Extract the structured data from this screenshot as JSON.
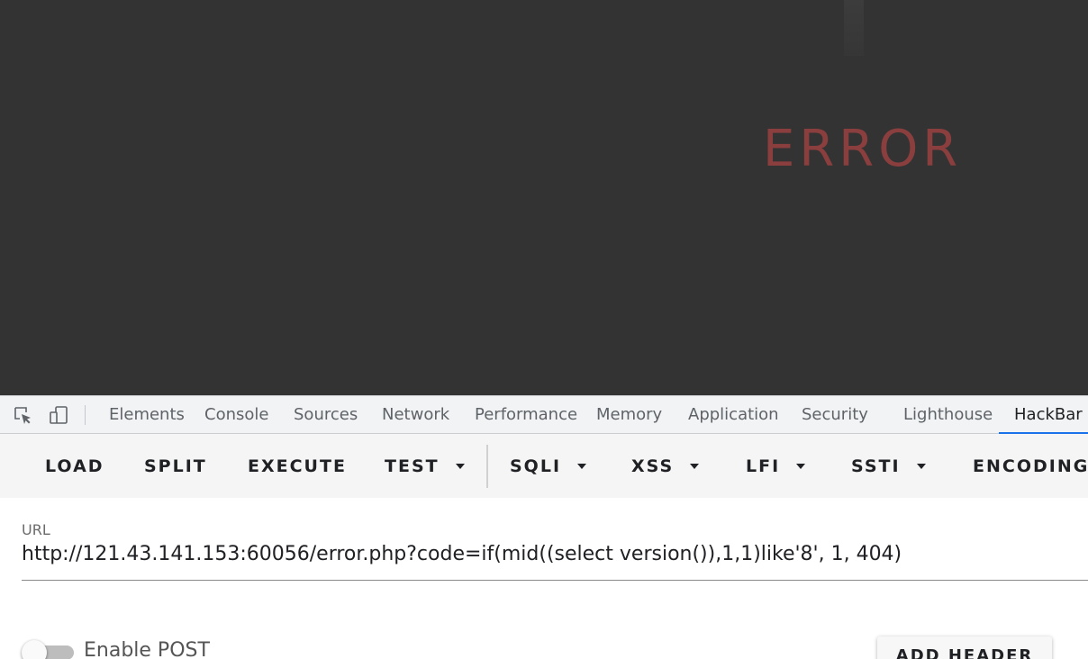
{
  "page": {
    "error_text": "ERROR"
  },
  "devtools": {
    "tabs": [
      {
        "label": "Elements"
      },
      {
        "label": "Console"
      },
      {
        "label": "Sources"
      },
      {
        "label": "Network"
      },
      {
        "label": "Performance"
      },
      {
        "label": "Memory"
      },
      {
        "label": "Application"
      },
      {
        "label": "Security"
      },
      {
        "label": "Lighthouse"
      },
      {
        "label": "HackBar"
      }
    ],
    "active_tab": "HackBar",
    "accent_color": "#1a73e8"
  },
  "hackbar": {
    "buttons": [
      {
        "label": "LOAD",
        "dropdown": false
      },
      {
        "label": "SPLIT",
        "dropdown": false
      },
      {
        "label": "EXECUTE",
        "dropdown": false
      },
      {
        "label": "TEST",
        "dropdown": true
      },
      {
        "label": "SQLI",
        "dropdown": true
      },
      {
        "label": "XSS",
        "dropdown": true
      },
      {
        "label": "LFI",
        "dropdown": true
      },
      {
        "label": "SSTI",
        "dropdown": true
      },
      {
        "label": "ENCODING",
        "dropdown": false
      }
    ],
    "url_label": "URL",
    "url_value": "http://121.43.141.153:60056/error.php?code=if(mid((select version()),1,1)like'8', 1, 404)",
    "enable_post_label": "Enable POST",
    "enable_post": false,
    "add_header_label": "ADD HEADER"
  }
}
